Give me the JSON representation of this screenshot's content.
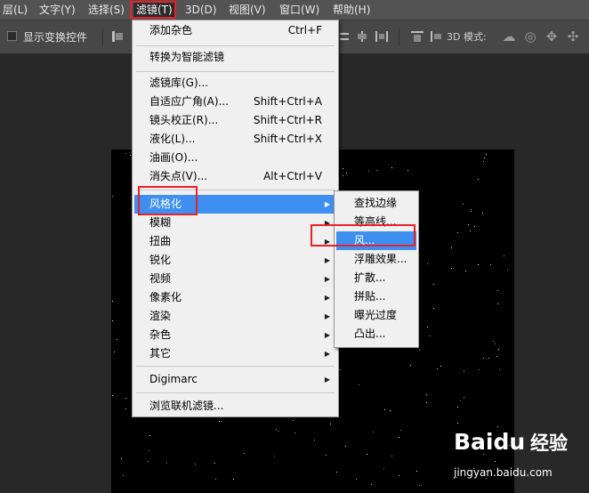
{
  "menubar": {
    "items": [
      {
        "label": "层(L)"
      },
      {
        "label": "文字(Y)"
      },
      {
        "label": "选择(S)"
      },
      {
        "label": "滤镜(T)"
      },
      {
        "label": "3D(D)"
      },
      {
        "label": "视图(V)"
      },
      {
        "label": "窗口(W)"
      },
      {
        "label": "帮助(H)"
      }
    ],
    "active_index": 3
  },
  "options": {
    "show_transform_controls": "显示变换控件",
    "mode_label": "3D 模式:"
  },
  "filter_menu": {
    "top": [
      {
        "label": "添加杂色",
        "shortcut": "Ctrl+F"
      }
    ],
    "group2": [
      {
        "label": "转换为智能滤镜"
      }
    ],
    "group3": [
      {
        "label": "滤镜库(G)...",
        "shortcut": ""
      },
      {
        "label": "自适应广角(A)...",
        "shortcut": "Shift+Ctrl+A"
      },
      {
        "label": "镜头校正(R)...",
        "shortcut": "Shift+Ctrl+R"
      },
      {
        "label": "液化(L)...",
        "shortcut": "Shift+Ctrl+X"
      },
      {
        "label": "油画(O)...",
        "shortcut": ""
      },
      {
        "label": "消失点(V)...",
        "shortcut": "Alt+Ctrl+V"
      }
    ],
    "categories": [
      {
        "label": "风格化"
      },
      {
        "label": "模糊"
      },
      {
        "label": "扭曲"
      },
      {
        "label": "锐化"
      },
      {
        "label": "视频"
      },
      {
        "label": "像素化"
      },
      {
        "label": "渲染"
      },
      {
        "label": "杂色"
      },
      {
        "label": "其它"
      }
    ],
    "digimarc": "Digimarc",
    "browse": "浏览联机滤镜..."
  },
  "stylize_submenu": {
    "items": [
      {
        "label": "查找边缘"
      },
      {
        "label": "等高线..."
      },
      {
        "label": "风..."
      },
      {
        "label": "浮雕效果..."
      },
      {
        "label": "扩散..."
      },
      {
        "label": "拼贴..."
      },
      {
        "label": "曝光过度"
      },
      {
        "label": "凸出..."
      }
    ],
    "highlighted_index": 2
  },
  "watermark": {
    "brand": "Baidu",
    "suffix": "经验",
    "url": "jingyan.baidu.com"
  },
  "colors": {
    "menu_highlight": "#3e8ff0",
    "annotation_red": "#e8202a"
  }
}
